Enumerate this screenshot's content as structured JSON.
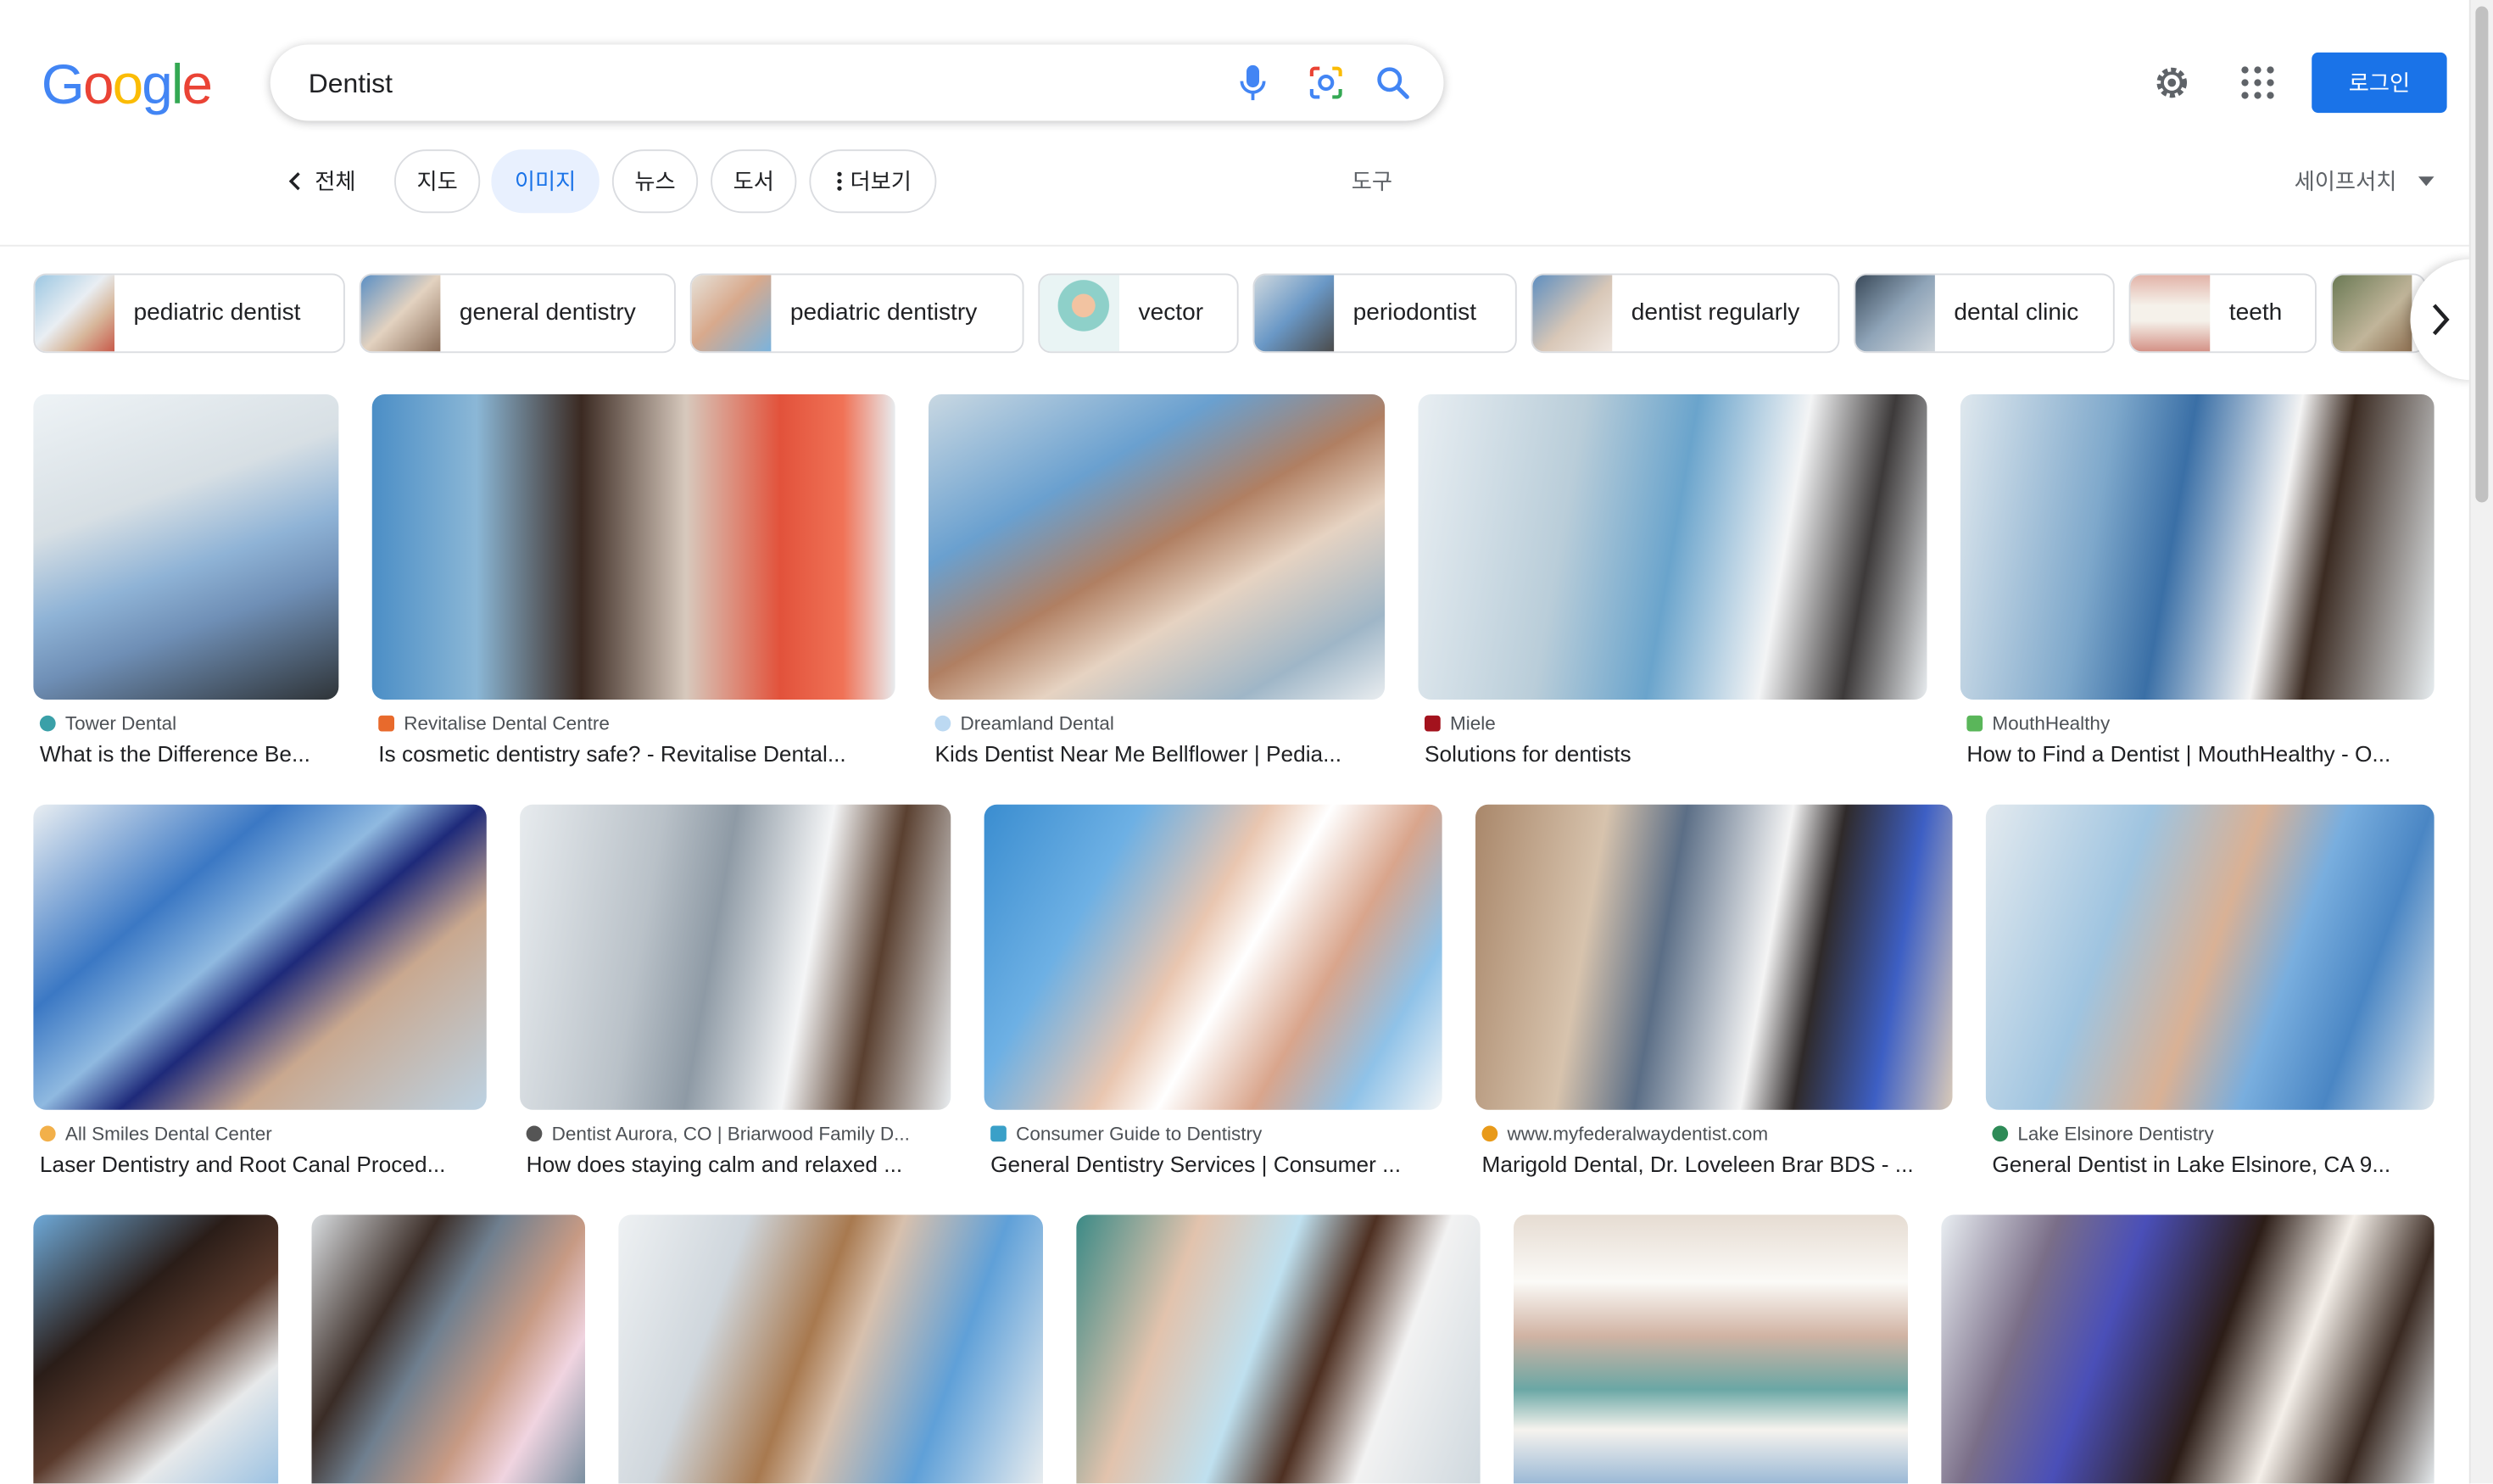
{
  "header": {
    "logo_letters": [
      "G",
      "o",
      "o",
      "g",
      "l",
      "e"
    ],
    "search_value": "Dentist",
    "login_label": "로그인"
  },
  "tabs": {
    "all_label": "전체",
    "items": [
      "지도",
      "이미지",
      "뉴스",
      "도서",
      "더보기"
    ],
    "active": "이미지",
    "tools_label": "도구",
    "safesearch_label": "세이프서치"
  },
  "chips": [
    "pediatric dentist",
    "general dentistry",
    "pediatric dentistry",
    "vector",
    "periodontist",
    "dentist regularly",
    "dental clinic",
    "teeth"
  ],
  "results": [
    {
      "source": "Tower Dental",
      "title": "What is the Difference Be...",
      "fav": "#3aa0a8"
    },
    {
      "source": "Revitalise Dental Centre",
      "title": "Is cosmetic dentistry safe? - Revitalise Dental...",
      "fav": "#e86a2c"
    },
    {
      "source": "Dreamland Dental",
      "title": "Kids Dentist Near Me Bellflower | Pedia...",
      "fav": "#bcd9f2"
    },
    {
      "source": "Miele",
      "title": "Solutions for dentists",
      "fav": "#a3121d"
    },
    {
      "source": "MouthHealthy",
      "title": "How to Find a Dentist | MouthHealthy - O...",
      "fav": "#5ab65a"
    },
    {
      "source": "All Smiles Dental Center",
      "title": "Laser Dentistry and Root Canal Proced...",
      "fav": "#f2b04a"
    },
    {
      "source": "Dentist Aurora, CO | Briarwood Family D...",
      "title": "How does staying calm and relaxed ...",
      "fav": "#555555"
    },
    {
      "source": "Consumer Guide to Dentistry",
      "title": "General Dentistry Services | Consumer ...",
      "fav": "#3aa0c8"
    },
    {
      "source": "www.myfederalwaydentist.com",
      "title": "Marigold Dental, Dr. Loveleen Brar BDS - ...",
      "fav": "#e89a1a"
    },
    {
      "source": "Lake Elsinore Dentistry",
      "title": "General Dentist in Lake Elsinore, CA 9...",
      "fav": "#2e8b57"
    }
  ],
  "colors": {
    "accent": "#1a73e8",
    "active_tab_bg": "#e8f0fe",
    "text": "#202124",
    "muted": "#5f6368"
  }
}
